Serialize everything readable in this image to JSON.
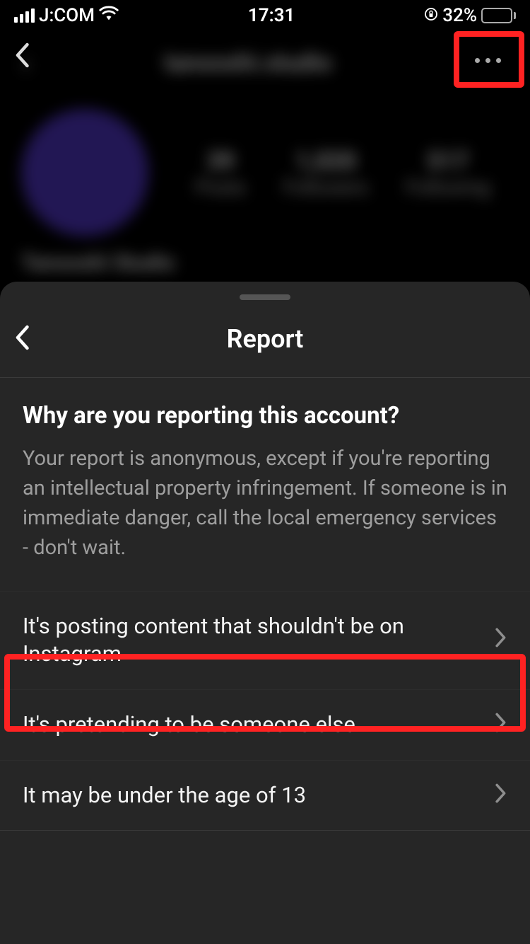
{
  "status": {
    "carrier": "J:COM",
    "time": "17:31",
    "battery_pct": "32%"
  },
  "profile": {
    "username": "tanooshi.studio",
    "name": "Tanooshi Studio",
    "stats": {
      "posts_num": "39",
      "posts_label": "Posts",
      "followers_num": "1,020",
      "followers_label": "Followers",
      "following_num": "517",
      "following_label": "Following"
    }
  },
  "sheet": {
    "title": "Report",
    "question": "Why are you reporting this account?",
    "description": "Your report is anonymous, except if you're reporting an intellectual property infringement. If someone is in immediate danger, call the local emergency services - don't wait.",
    "options": [
      {
        "label": "It's posting content that shouldn't be on Instagram"
      },
      {
        "label": "It's pretending to be someone else"
      },
      {
        "label": "It may be under the age of 13"
      }
    ]
  }
}
